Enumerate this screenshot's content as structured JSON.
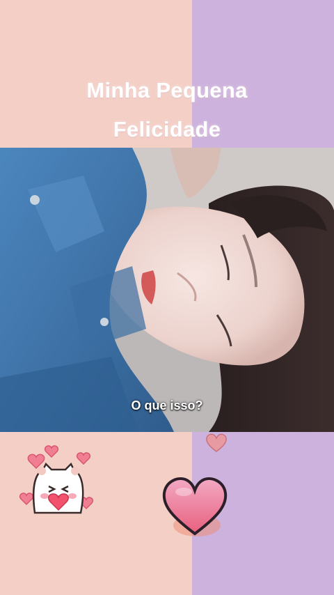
{
  "title": {
    "line1": "Minha Pequena",
    "line2": "Felicidade"
  },
  "video": {
    "subtitle": "O que isso?"
  },
  "colors": {
    "left_panel": "#f4cfc6",
    "right_panel": "#cdb2dd",
    "denim": "#4a7fb2",
    "heart_outline": "#3a2a3a"
  },
  "stickers": [
    "cat-with-hearts-icon",
    "heart-icon",
    "small-heart-icon"
  ]
}
